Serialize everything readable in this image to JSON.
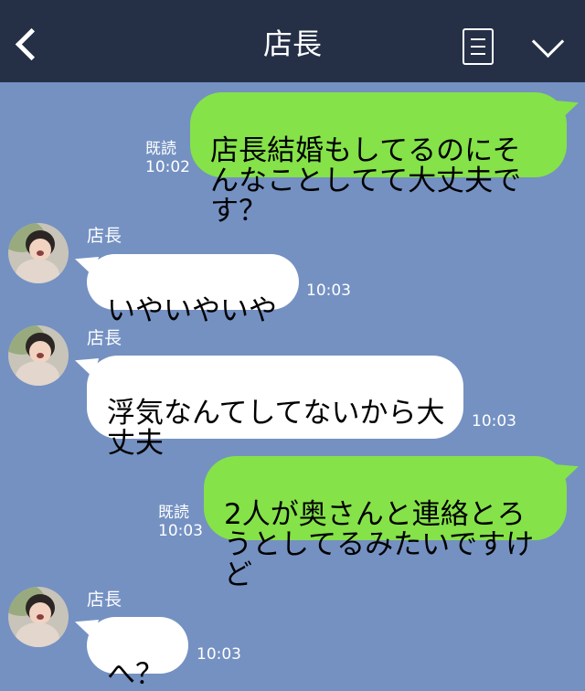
{
  "header": {
    "title": "店長",
    "icons": {
      "back": "chevron-left-icon",
      "notes": "notes-icon",
      "dropdown": "chevron-down-icon"
    }
  },
  "colors": {
    "header_bg": "#253047",
    "chat_bg": "#7491c2",
    "sent_bubble": "#85e249",
    "recv_bubble": "#ffffff",
    "text_white": "#ffffff"
  },
  "messages": [
    {
      "type": "sent",
      "text": "店長結婚もしてるのにそんなことしてて大丈夫です？",
      "read": "既読",
      "time": "10:02"
    },
    {
      "type": "received",
      "sender": "店長",
      "text": "いやいやいや",
      "time": "10:03"
    },
    {
      "type": "received",
      "sender": "店長",
      "text": "浮気なんてしてないから大丈夫",
      "time": "10:03"
    },
    {
      "type": "sent",
      "text": "2人が奥さんと連絡とろうとしてるみたいですけど",
      "read": "既読",
      "time": "10:03"
    },
    {
      "type": "received",
      "sender": "店長",
      "text": "へ？",
      "time": "10:03"
    }
  ]
}
